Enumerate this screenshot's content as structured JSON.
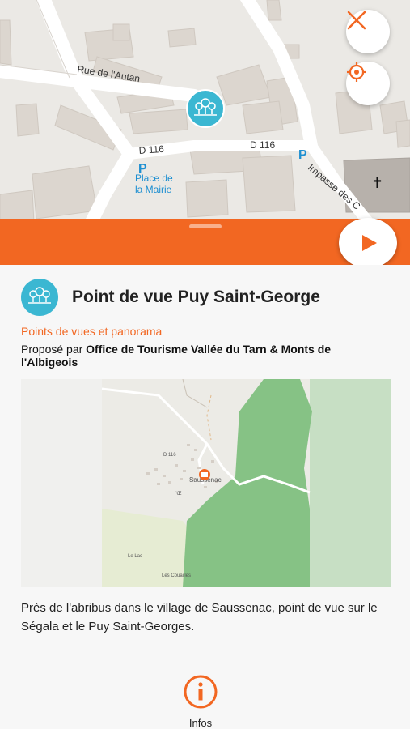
{
  "map": {
    "street_rue_autan": "Rue de l'Autan",
    "road_d116_left": "D 116",
    "road_d116_right": "D 116",
    "parking_symbol": "P",
    "place_label_line1": "Place de",
    "place_label_line2": "la Mairie",
    "street_impasse": "Impasse des C",
    "church_symbol": "✝",
    "close_icon": "close-icon",
    "locate_icon": "crosshair-icon",
    "marker_icon": "trees-icon"
  },
  "bar": {
    "play_icon": "play-icon"
  },
  "poi": {
    "title": "Point de vue Puy Saint-George",
    "category": "Points de vues et panorama",
    "provider_prefix": "Proposé par ",
    "provider_name": "Office de Tourisme Vallée du Tarn & Monts de l'Albigeois",
    "description": "Près de l'abribus dans le village de Saussenac, point de vue sur le Ségala et le Puy Saint-Georges.",
    "minimap": {
      "road_label": "D 116",
      "village_label": "Saussenac",
      "lac_label": "Le Lac",
      "couailles_label": "Les Couailles",
      "small_label": "l'Œ"
    }
  },
  "bottom_tab": {
    "label": "Infos",
    "icon": "info-icon"
  },
  "colors": {
    "accent": "#f26722",
    "marker": "#3bb7d2",
    "parking": "#1d8fd1",
    "forest": "#86c285"
  }
}
